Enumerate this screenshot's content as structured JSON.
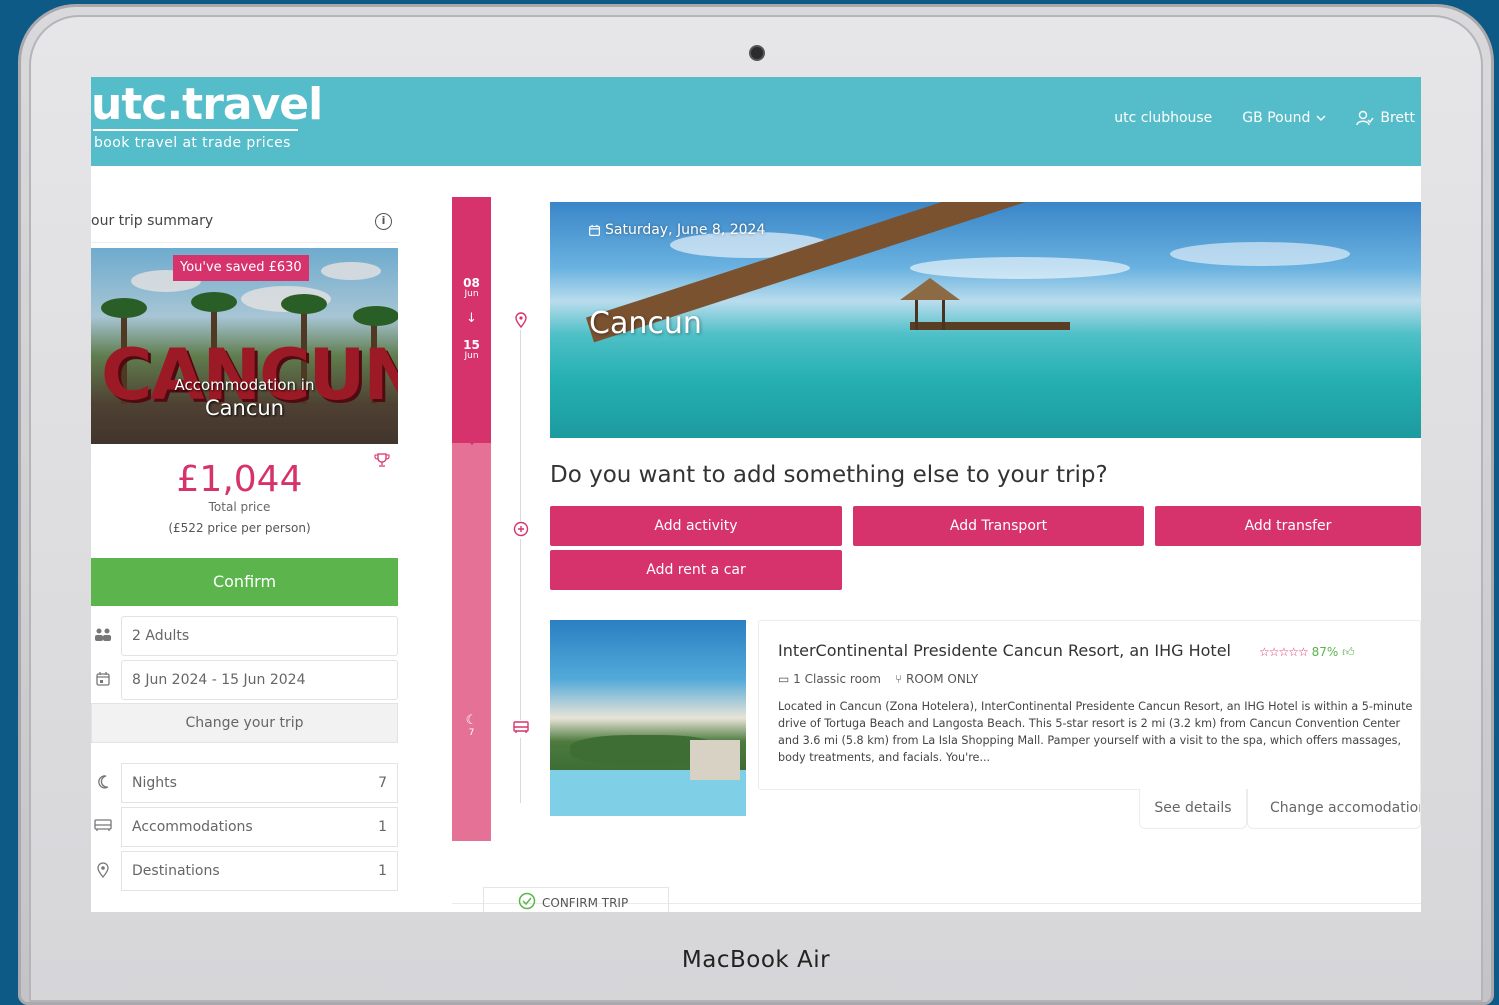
{
  "device": {
    "label": "MacBook Air"
  },
  "header": {
    "logo": "utc.travel",
    "tagline": "book travel at trade prices",
    "nav": {
      "clubhouse": "utc clubhouse",
      "currency": "GB Pound",
      "user": "Brett"
    }
  },
  "sidebar": {
    "summary_title": "our trip summary",
    "saved_badge": "You've saved £630",
    "hero_label": "Accommodation in",
    "hero_city": "Cancun",
    "price": "£1,044",
    "price_label": "Total price",
    "price_per_person": "(£522 price per person)",
    "confirm_label": "Confirm",
    "travellers": "2 Adults",
    "dates": "8 Jun 2024 - 15 Jun 2024",
    "change_label": "Change your trip",
    "stats": [
      {
        "label": "Nights",
        "value": "7"
      },
      {
        "label": "Accommodations",
        "value": "1"
      },
      {
        "label": "Destinations",
        "value": "1"
      }
    ]
  },
  "timeline": {
    "start_day": "08",
    "start_month": "Jun",
    "end_day": "15",
    "end_month": "Jun",
    "nights": "7"
  },
  "banner": {
    "date": "Saturday, June 8, 2024",
    "city": "Cancun"
  },
  "addons": {
    "question": "Do you want to add something else to your trip?",
    "buttons": {
      "activity": "Add activity",
      "transport": "Add Transport",
      "transfer": "Add transfer",
      "car": "Add rent a car"
    }
  },
  "hotel": {
    "name": "InterContinental Presidente Cancun Resort, an IHG Hotel",
    "score": "87%",
    "room": "1 Classic room",
    "board": "ROOM ONLY",
    "description": "Located in Cancun (Zona Hotelera), InterContinental Presidente Cancun Resort, an IHG Hotel is within a 5-minute drive of Tortuga Beach and Langosta Beach. This 5-star resort is 2 mi (3.2 km) from Cancun Convention Center and 3.6 mi (5.8 km) from La Isla Shopping Mall. Pamper yourself with a visit to the spa, which offers massages, body treatments, and facials. You're...",
    "see_details": "See details",
    "change_accommodation": "Change accomodation"
  },
  "footer": {
    "confirm_trip": "CONFIRM TRIP"
  },
  "colors": {
    "header_bg": "#55bcc9",
    "accent_pink": "#d6336c",
    "confirm_green": "#5bb54c"
  }
}
